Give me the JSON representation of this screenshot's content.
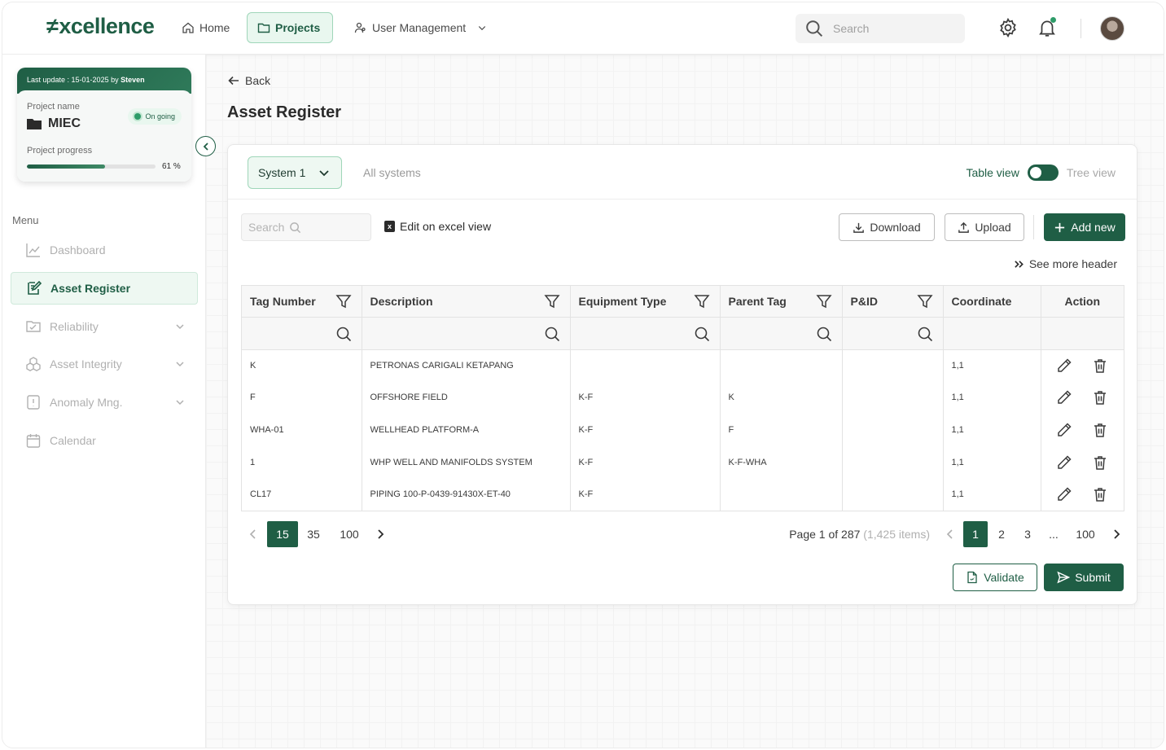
{
  "app": {
    "logo_mark": "≠",
    "logo_text": "xcellence"
  },
  "topnav": {
    "home": "Home",
    "projects": "Projects",
    "user_management": "User Management",
    "search_placeholder": "Search"
  },
  "project_card": {
    "last_update_prefix": "Last update : 15-01-2025 by ",
    "last_update_user": "Steven",
    "project_name_label": "Project name",
    "project_name": "MIEC",
    "status": "On going",
    "progress_label": "Project progress",
    "progress_value": "61 %",
    "progress_fraction": 0.61
  },
  "sidebar": {
    "menu_title": "Menu",
    "items": [
      {
        "label": "Dashboard",
        "icon": "chart-icon"
      },
      {
        "label": "Asset Register",
        "icon": "edit-register-icon",
        "active": true
      },
      {
        "label": "Reliability",
        "icon": "reliability-icon",
        "expandable": true
      },
      {
        "label": "Asset Integrity",
        "icon": "integrity-icon",
        "expandable": true
      },
      {
        "label": "Anomaly Mng.",
        "icon": "anomaly-icon",
        "expandable": true
      },
      {
        "label": "Calendar",
        "icon": "calendar-icon"
      }
    ]
  },
  "page": {
    "back": "Back",
    "title": "Asset Register"
  },
  "system_bar": {
    "selected_system": "System 1",
    "all_systems": "All systems",
    "table_view": "Table view",
    "tree_view": "Tree view"
  },
  "toolbar": {
    "search_placeholder": "Search",
    "edit_excel": "Edit on excel view",
    "download": "Download",
    "upload": "Upload",
    "add_new": "Add new",
    "see_more_header": "See more header"
  },
  "table": {
    "columns": [
      "Tag Number",
      "Description",
      "Equipment Type",
      "Parent Tag",
      "P&ID",
      "Coordinate",
      "Action"
    ],
    "rows": [
      [
        "K",
        "PETRONAS CARIGALI KETAPANG",
        "",
        "",
        "",
        "1,1"
      ],
      [
        "F",
        "OFFSHORE FIELD",
        "K-F",
        "K",
        "",
        "1,1"
      ],
      [
        "WHA-01",
        "WELLHEAD PLATFORM-A",
        "K-F",
        "F",
        "",
        "1,1"
      ],
      [
        "1",
        "WHP WELL AND MANIFOLDS SYSTEM",
        "K-F",
        "K-F-WHA",
        "",
        "1,1"
      ],
      [
        "CL17",
        "PIPING 100-P-0439-91430X-ET-40",
        "K-F",
        "",
        "",
        "1,1"
      ]
    ]
  },
  "pagination": {
    "page_sizes": [
      "15",
      "35",
      "100"
    ],
    "page_info": "Page 1 of 287",
    "items_info": "(1,425 items)",
    "pages": [
      "1",
      "2",
      "3",
      "...",
      "100"
    ]
  },
  "footer": {
    "validate": "Validate",
    "submit": "Submit"
  },
  "colors": {
    "brand": "#1f5e45",
    "brand_light": "#eef8f2",
    "status_green": "#2e9c69"
  }
}
